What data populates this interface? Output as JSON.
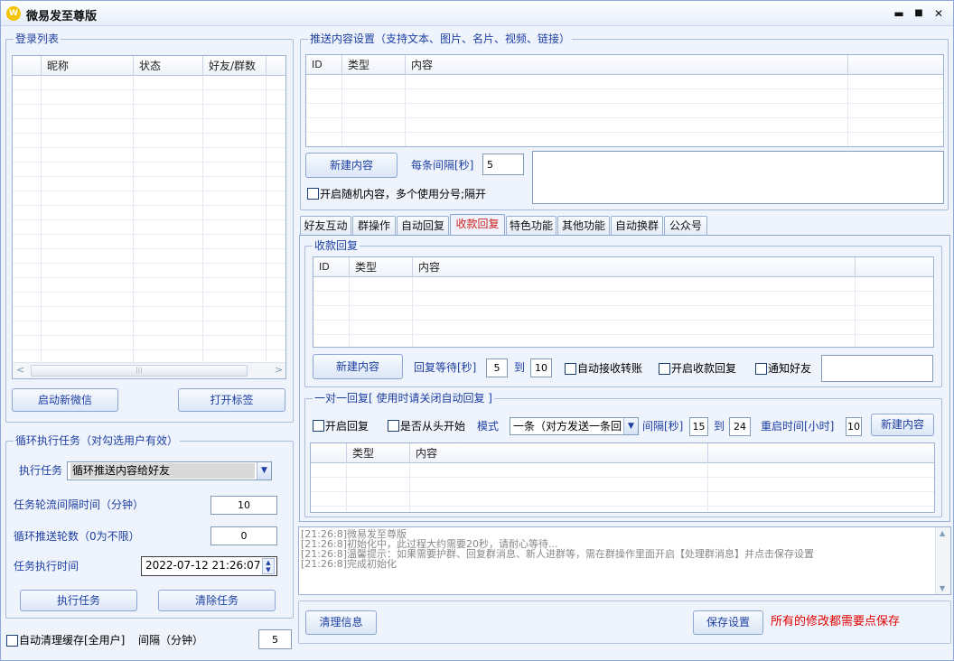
{
  "app": {
    "logo": "W",
    "title": "微易发至尊版",
    "minimize": "▬",
    "maximize": "■",
    "close": "✕"
  },
  "login": {
    "title": "登录列表",
    "columns": [
      "",
      "昵称",
      "状态",
      "好友/群数"
    ],
    "start_btn": "启动新微信",
    "open_btn": "打开标签",
    "scroll_left": "<",
    "scroll_right": ">",
    "scroll_thumb": "|||"
  },
  "loop": {
    "title": "循环执行任务（对勾选用户有效）",
    "task_label": "执行任务",
    "task_value": "循环推送内容给好友",
    "interval_label": "任务轮流间隔时间（分钟）",
    "interval_value": "10",
    "rounds_label": "循环推送轮数（0为不限）",
    "rounds_value": "0",
    "time_label": "任务执行时间",
    "time_value": "2022-07-12 21:26:07",
    "run_btn": "执行任务",
    "clear_btn": "清除任务"
  },
  "bottom_left": {
    "cache_label": "自动清理缓存[全用户]",
    "interval_label": "间隔（分钟）",
    "interval_value": "5"
  },
  "push": {
    "title": "推送内容设置（支持文本、图片、名片、视频、链接）",
    "columns": [
      "ID",
      "类型",
      "内容",
      ""
    ],
    "new_btn": "新建内容",
    "each_interval_label": "每条间隔[秒]",
    "each_interval_value": "5",
    "random_label": "开启随机内容，多个使用分号;隔开"
  },
  "tabs": [
    "好友互动",
    "群操作",
    "自动回复",
    "收款回复",
    "特色功能",
    "其他功能",
    "自动换群",
    "公众号"
  ],
  "receipt": {
    "title": "收款回复",
    "columns": [
      "ID",
      "类型",
      "内容",
      ""
    ],
    "new_btn": "新建内容",
    "wait_label": "回复等待[秒]",
    "wait_from": "5",
    "to_label": "到",
    "wait_to": "10",
    "auto_accept_label": "自动接收转账",
    "enable_label": "开启收款回复",
    "notify_label": "通知好友"
  },
  "one2one": {
    "title": "一对一回复[ 使用时请关闭自动回复 ]",
    "enable_label": "开启回复",
    "from_start_label": "是否从头开始",
    "mode_label": "模式",
    "mode_value": "一条（对方发送一条回",
    "interval_label": "间隔[秒]",
    "interval_from": "15",
    "to_label": "到",
    "interval_to": "24",
    "restart_label": "重启时间[小时]",
    "restart_value": "10",
    "new_btn": "新建内容",
    "columns": [
      "",
      "类型",
      "内容",
      ""
    ]
  },
  "log": {
    "lines": [
      "[21:26:8]微易发至尊版",
      "[21:26:8]初始化中，此过程大约需要20秒，请耐心等待...",
      "[21:26:8]温馨提示：如果需要护群、回复群消息、新人进群等，需在群操作里面开启【处理群消息】并点击保存设置",
      "[21:26:8]完成初始化"
    ],
    "scroll_up": "▲",
    "scroll_down": "▼"
  },
  "footer": {
    "clear_btn": "清理信息",
    "save_btn": "保存设置",
    "notice": "所有的修改都需要点保存"
  },
  "colors": {
    "accent": "#1d3fa3",
    "notice": "#e00000",
    "active_tab": "#d02020"
  }
}
